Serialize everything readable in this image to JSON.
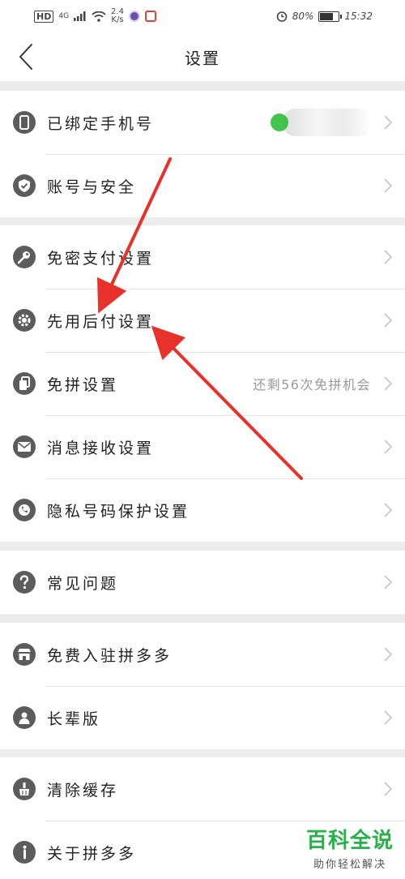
{
  "status_bar": {
    "hd": "HD",
    "network": "4G",
    "speed_value": "2.4",
    "speed_unit": "K/s",
    "battery": "80%",
    "time": "15:32"
  },
  "nav": {
    "title": "设置",
    "back_icon": "chevron-left-icon"
  },
  "groups": [
    {
      "items": [
        {
          "label": "已绑定手机号",
          "icon": "phone-icon",
          "value": ""
        },
        {
          "label": "账号与安全",
          "icon": "shield-icon",
          "value": ""
        }
      ]
    },
    {
      "items": [
        {
          "label": "免密支付设置",
          "icon": "key-icon",
          "value": ""
        },
        {
          "label": "先用后付设置",
          "icon": "gear-icon",
          "value": ""
        },
        {
          "label": "免拼设置",
          "icon": "copy-icon",
          "value": "还剩56次免拼机会"
        },
        {
          "label": "消息接收设置",
          "icon": "mail-icon",
          "value": ""
        },
        {
          "label": "隐私号码保护设置",
          "icon": "privacy-icon",
          "value": ""
        }
      ]
    },
    {
      "items": [
        {
          "label": "常见问题",
          "icon": "question-icon",
          "value": ""
        }
      ]
    },
    {
      "items": [
        {
          "label": "免费入驻拼多多",
          "icon": "store-icon",
          "value": ""
        },
        {
          "label": "长辈版",
          "icon": "elder-icon",
          "value": ""
        }
      ]
    },
    {
      "items": [
        {
          "label": "清除缓存",
          "icon": "broom-icon",
          "value": ""
        },
        {
          "label": "关于拼多多",
          "icon": "info-icon",
          "value": ""
        }
      ]
    }
  ],
  "colors": {
    "accent_arrow": "#e8312a",
    "watermark": "#2ab04a",
    "icon_bg": "#5c5c5c",
    "divider": "#ececec"
  },
  "watermark": {
    "title": "百科全说",
    "subtitle": "助你轻松解决"
  }
}
